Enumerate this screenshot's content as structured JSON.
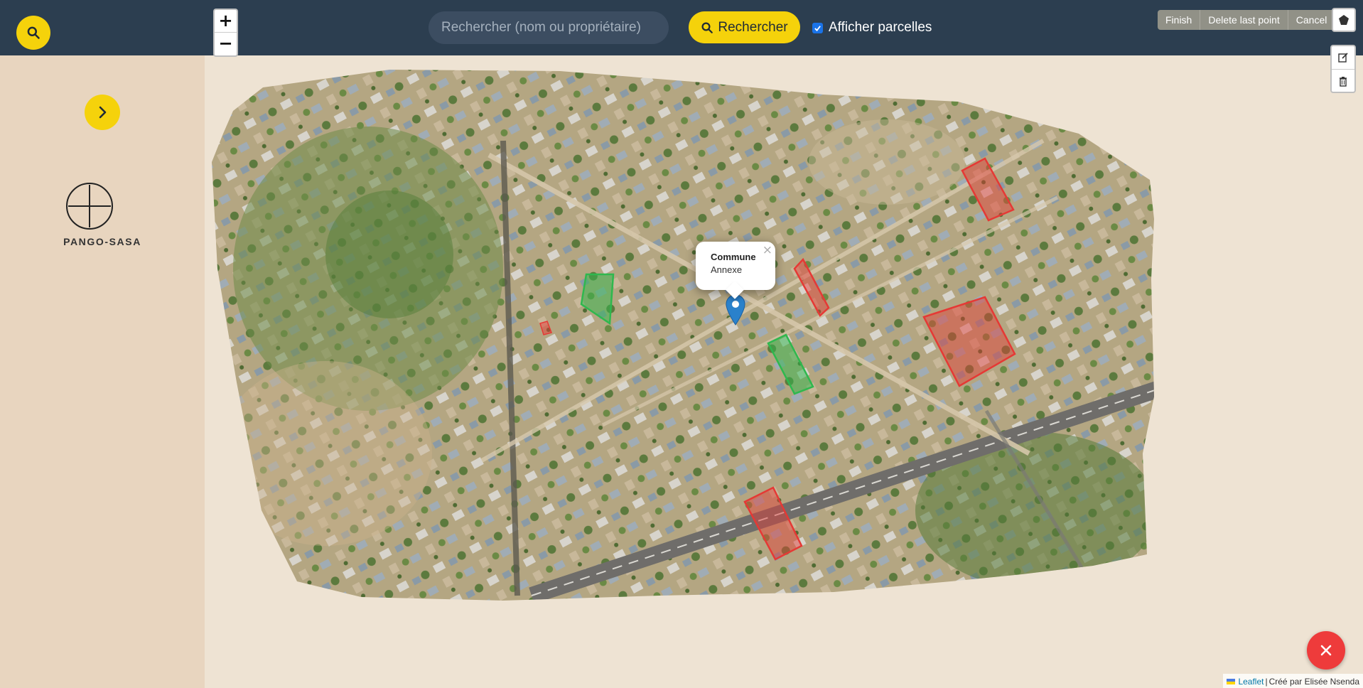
{
  "topbar": {
    "search_placeholder": "Rechercher (nom ou propriétaire)",
    "search_button_label": "Rechercher",
    "toggle_label": "Afficher parcelles",
    "toggle_checked": true,
    "zoom_in_label": "+",
    "zoom_out_label": "−"
  },
  "draw_toolbar": {
    "actions": [
      "Finish",
      "Delete last point",
      "Cancel"
    ]
  },
  "sidebar": {
    "brand_name": "PANGO-SASA"
  },
  "map": {
    "popup": {
      "title": "Commune",
      "body": "Annexe",
      "close": "×"
    },
    "parcel_colors": {
      "owned": "#e53935",
      "free": "#2fb84e"
    }
  },
  "attribution": {
    "link_text": "Leaflet",
    "separator": "|",
    "credit": "Créé par Elisée Nsenda"
  },
  "colors": {
    "topbar": "#2c3e50",
    "accent": "#f5d20b",
    "sidebar": "#e8d5bf",
    "danger": "#ee3b3b"
  }
}
